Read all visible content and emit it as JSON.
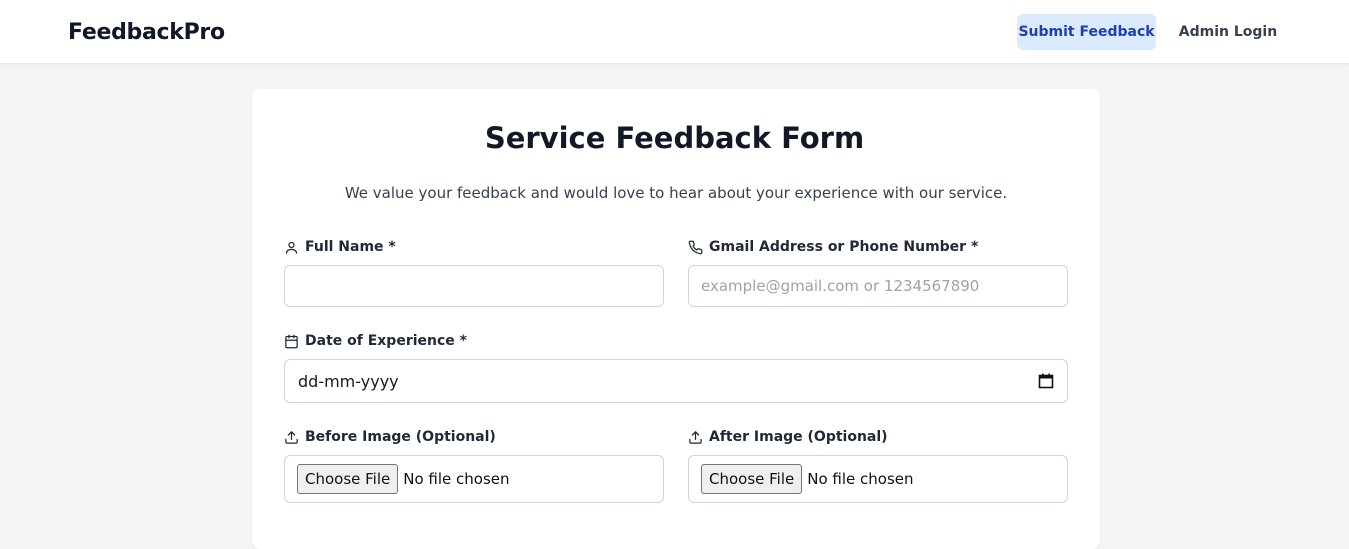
{
  "nav": {
    "brand": "FeedbackPro",
    "submit_label": "Submit Feedback",
    "admin_label": "Admin Login"
  },
  "form": {
    "title": "Service Feedback Form",
    "subtitle": "We value your feedback and would love to hear about your experience with our service.",
    "full_name": {
      "label": "Full Name *",
      "value": "",
      "icon": "user-icon"
    },
    "contact": {
      "label": "Gmail Address or Phone Number *",
      "placeholder": "example@gmail.com or 1234567890",
      "icon": "phone-icon"
    },
    "date": {
      "label": "Date of Experience *",
      "value": "dd-mm-yyyy",
      "icon": "calendar-icon"
    },
    "before_image": {
      "label": "Before Image (Optional)",
      "button": "Choose File",
      "status": "No file chosen",
      "icon": "upload-icon"
    },
    "after_image": {
      "label": "After Image (Optional)",
      "button": "Choose File",
      "status": "No file chosen",
      "icon": "upload-icon"
    }
  },
  "colors": {
    "page_bg": "#f3f4f6",
    "accent_bg": "#dbeafe",
    "accent_text": "#1e40af"
  }
}
